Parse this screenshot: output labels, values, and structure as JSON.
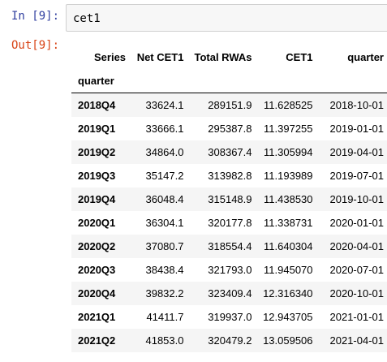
{
  "cell": {
    "in_prompt": "In [9]:",
    "code": "cet1",
    "out_prompt": "Out[9]:"
  },
  "table": {
    "columns_label": "Series",
    "columns": [
      "Net CET1",
      "Total RWAs",
      "CET1",
      "quarter"
    ],
    "index_name": "quarter",
    "rows": [
      {
        "index": "2018Q4",
        "values": [
          "33624.1",
          "289151.9",
          "11.628525",
          "2018-10-01"
        ]
      },
      {
        "index": "2019Q1",
        "values": [
          "33666.1",
          "295387.8",
          "11.397255",
          "2019-01-01"
        ]
      },
      {
        "index": "2019Q2",
        "values": [
          "34864.0",
          "308367.4",
          "11.305994",
          "2019-04-01"
        ]
      },
      {
        "index": "2019Q3",
        "values": [
          "35147.2",
          "313982.8",
          "11.193989",
          "2019-07-01"
        ]
      },
      {
        "index": "2019Q4",
        "values": [
          "36048.4",
          "315148.9",
          "11.438530",
          "2019-10-01"
        ]
      },
      {
        "index": "2020Q1",
        "values": [
          "36304.1",
          "320177.8",
          "11.338731",
          "2020-01-01"
        ]
      },
      {
        "index": "2020Q2",
        "values": [
          "37080.7",
          "318554.4",
          "11.640304",
          "2020-04-01"
        ]
      },
      {
        "index": "2020Q3",
        "values": [
          "38438.4",
          "321793.0",
          "11.945070",
          "2020-07-01"
        ]
      },
      {
        "index": "2020Q4",
        "values": [
          "39832.2",
          "323409.4",
          "12.316340",
          "2020-10-01"
        ]
      },
      {
        "index": "2021Q1",
        "values": [
          "41411.7",
          "319937.0",
          "12.943705",
          "2021-01-01"
        ]
      },
      {
        "index": "2021Q2",
        "values": [
          "41853.0",
          "320479.2",
          "13.059506",
          "2021-04-01"
        ]
      }
    ]
  }
}
